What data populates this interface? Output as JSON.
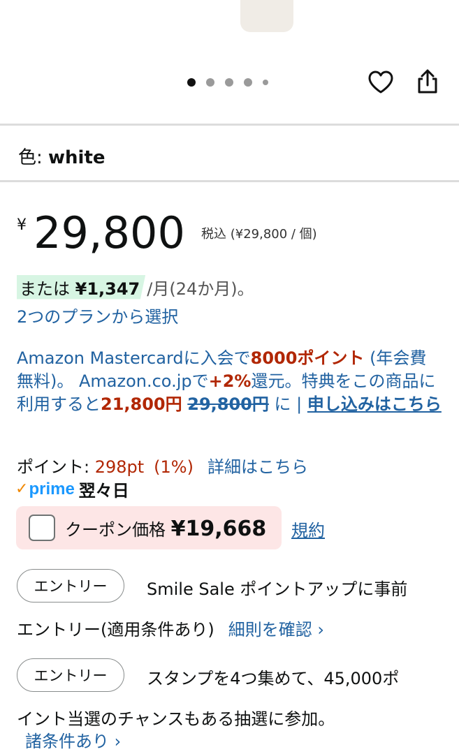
{
  "gallery": {
    "image_count": 5,
    "active_index": 0
  },
  "variant": {
    "label": "色: ",
    "value": "white"
  },
  "price": {
    "currency": "¥",
    "amount": "29,800",
    "tax_note": "税込 (¥29,800 / 個)"
  },
  "installment": {
    "prefix": "または",
    "amount": "¥1,347",
    "suffix": "/月(24か月)。",
    "plans_link": "2つのプランから選択"
  },
  "promo": {
    "p1": "Amazon Mastercardに入会で",
    "points": "8000ポイント",
    "p2": " (年会費無料)。 Amazon.co.jpで",
    "rate": "+2%",
    "p3": "還元。特典をこの商品に利用すると",
    "discounted": "21,800円",
    "original": "29,800円",
    "p4": " に | ",
    "apply_link": "申し込みはこちら"
  },
  "points": {
    "label": "ポイント: ",
    "value": "298pt",
    "percent": "(1%)",
    "details_link": "詳細はこちら"
  },
  "delivery": {
    "check": "✓",
    "prime": "prime",
    "text": "翌々日"
  },
  "coupon": {
    "label": "クーポン価格 ",
    "price": "¥19,668",
    "terms_link": "規約"
  },
  "entries": [
    {
      "button": "エントリー",
      "line1": "Smile Sale ポイントアップに事前",
      "line2": "エントリー(適用条件あり)",
      "link": "細則を確認 ›"
    },
    {
      "button": "エントリー",
      "line1": "スタンプを4つ集めて、45,000ポ",
      "line2": "イント当選のチャンスもある抽選に参加。",
      "link": "諸条件あり ›"
    }
  ]
}
